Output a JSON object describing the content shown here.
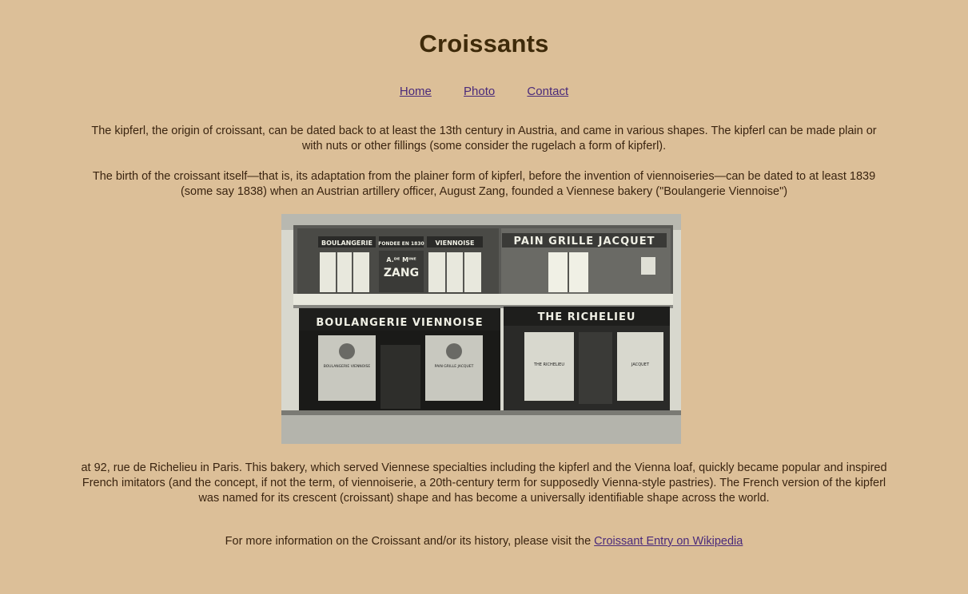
{
  "page": {
    "title": "Croissants"
  },
  "nav": {
    "items": [
      {
        "label": "Home"
      },
      {
        "label": "Photo"
      },
      {
        "label": "Contact"
      }
    ]
  },
  "content": {
    "p1": "The kipferl, the origin of croissant, can be dated back to at least the 13th century in Austria, and came in various shapes. The kipferl can be made plain or with nuts or other fillings (some consider the rugelach a form of kipferl).",
    "p2": "The birth of the croissant itself—that is, its adaptation from the plainer form of kipferl, before the invention of viennoiseries—can be dated to at least 1839 (some say 1838) when an Austrian artillery officer, August Zang, founded a Viennese bakery (\"Boulangerie Viennoise\")",
    "p3": "at 92, rue de Richelieu in Paris. This bakery, which served Viennese specialties including the kipferl and the Vienna loaf, quickly became popular and inspired French imitators (and the concept, if not the term, of viennoiserie, a 20th-century term for supposedly Vienna-style pastries). The French version of the kipferl was named for its crescent (croissant) shape and has become a universally identifiable shape across the world.",
    "p4_prefix": "For more information on the Croissant and/or its history, please visit the ",
    "p4_link": "Croissant Entry on Wikipedia"
  },
  "photo": {
    "signs": {
      "top_left_1": "BOULANGERIE",
      "top_left_2": "FONDEE EN 1830",
      "top_left_3": "VIENNOISE",
      "top_right": "PAIN GRILLE JACQUET",
      "name_1": "A.ᴰᴱ Mᴵᴺᴱ",
      "name_2": "ZANG",
      "shop_left": "BOULANGERIE VIENNOISE",
      "shop_right": "THE RICHELIEU",
      "window_1": "BOULANGERIE VIENNOISE",
      "window_2": "PAIN GRILLE JACQUET",
      "window_3": "THE RICHELIEU",
      "window_4": "JACQUET"
    }
  },
  "colors": {
    "background": "#dcbf98",
    "link": "#4a2a7a",
    "text": "#3a2410"
  }
}
